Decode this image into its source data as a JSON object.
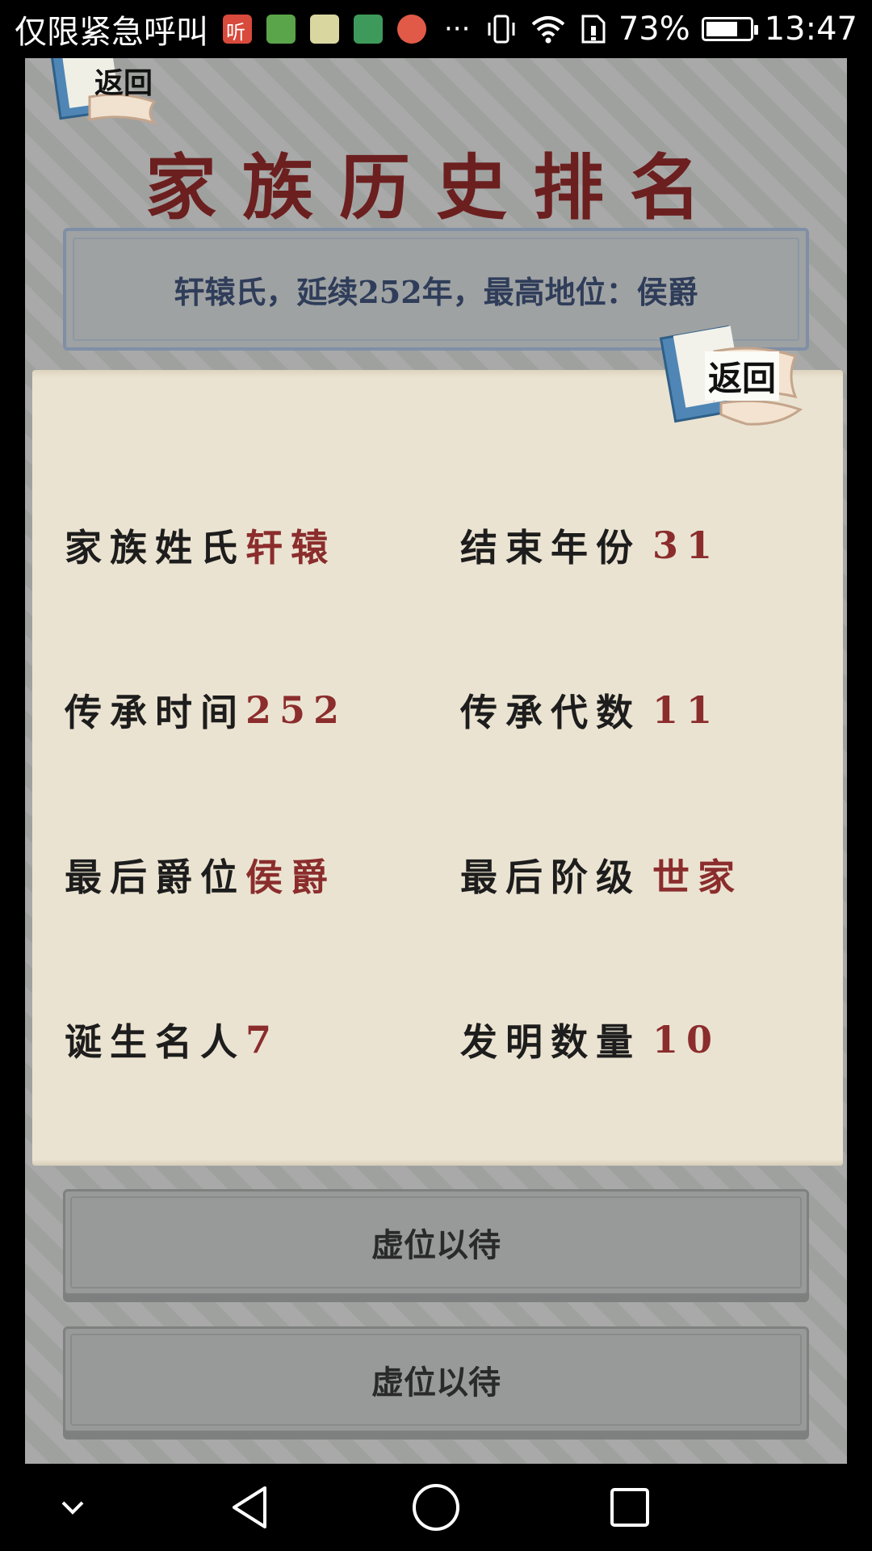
{
  "status_bar": {
    "carrier": "仅限紧急呼叫",
    "app_icons": [
      {
        "name": "listen-app-icon",
        "color": "#d84a3c",
        "glyph": "听"
      },
      {
        "name": "contacts-app-icon",
        "color": "#5aa54a",
        "glyph": ""
      },
      {
        "name": "clapper-app-icon",
        "color": "#d9d6a0",
        "glyph": ""
      },
      {
        "name": "key-app-icon",
        "color": "#3e9a5a",
        "glyph": ""
      },
      {
        "name": "blocked-app-icon",
        "color": "#e15a47",
        "glyph": ""
      }
    ],
    "more": "···",
    "battery_text": "73%",
    "battery_level": 0.73,
    "time": "13:47"
  },
  "game": {
    "top_back_label": "返回",
    "title": "家族历史排名",
    "summary": "轩辕氏，延续252年，最高地位：侯爵",
    "slots": [
      {
        "label": "虚位以待"
      },
      {
        "label": "虚位以待"
      }
    ]
  },
  "popup": {
    "back_label": "返回",
    "fields": [
      {
        "label": "家族姓氏",
        "value": "轩辕"
      },
      {
        "label": "结束年份",
        "value": "31"
      },
      {
        "label": "传承时间",
        "value": "252"
      },
      {
        "label": "传承代数",
        "value": "11"
      },
      {
        "label": "最后爵位",
        "value": "侯爵"
      },
      {
        "label": "最后阶级",
        "value": "世家"
      },
      {
        "label": "诞生名人",
        "value": "7"
      },
      {
        "label": "发明数量",
        "value": "10"
      }
    ]
  },
  "colors": {
    "title": "#6c1f1f",
    "value_red": "#8b2d2d",
    "paper": "#ebe3d1",
    "summary_text": "#2f3d5a"
  }
}
